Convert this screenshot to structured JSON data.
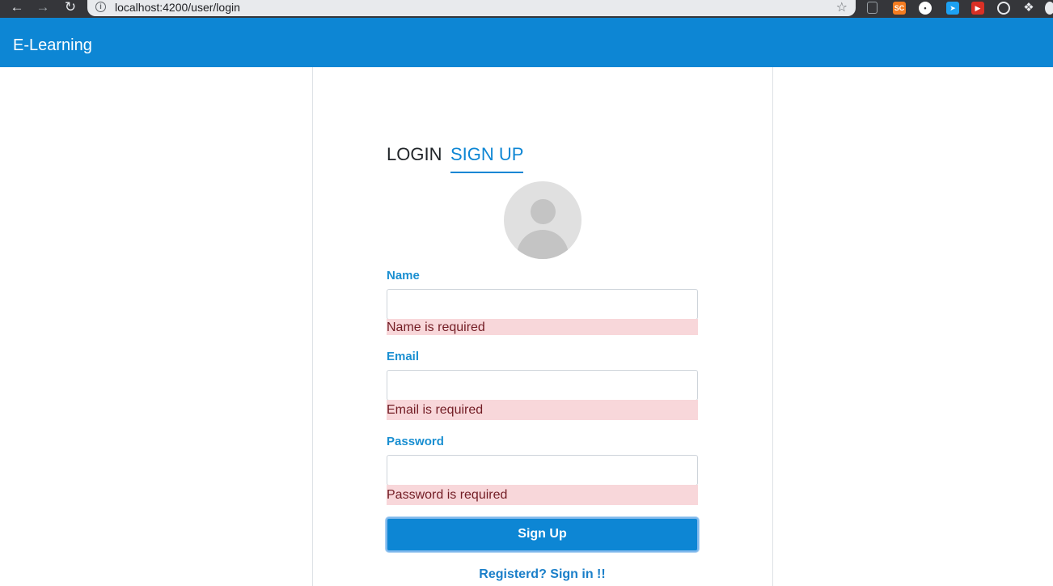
{
  "browser": {
    "url": "localhost:4200/user/login",
    "extensions": [
      "SC"
    ]
  },
  "header": {
    "title": "E-Learning"
  },
  "tabs": {
    "login": "LOGIN",
    "signup": "SIGN UP",
    "active": "signup"
  },
  "form": {
    "fields": [
      {
        "label": "Name",
        "value": "",
        "error": "Name is required"
      },
      {
        "label": "Email",
        "value": "",
        "error": "Email is required"
      },
      {
        "label": "Password",
        "value": "",
        "error": "Password is required"
      }
    ],
    "submit_label": "Sign Up",
    "signin_link": "Registerd? Sign in !!"
  },
  "colors": {
    "primary": "#0d86d4",
    "label": "#1a8fd1",
    "error_bg": "#f8d7da",
    "error_text": "#721c24"
  }
}
